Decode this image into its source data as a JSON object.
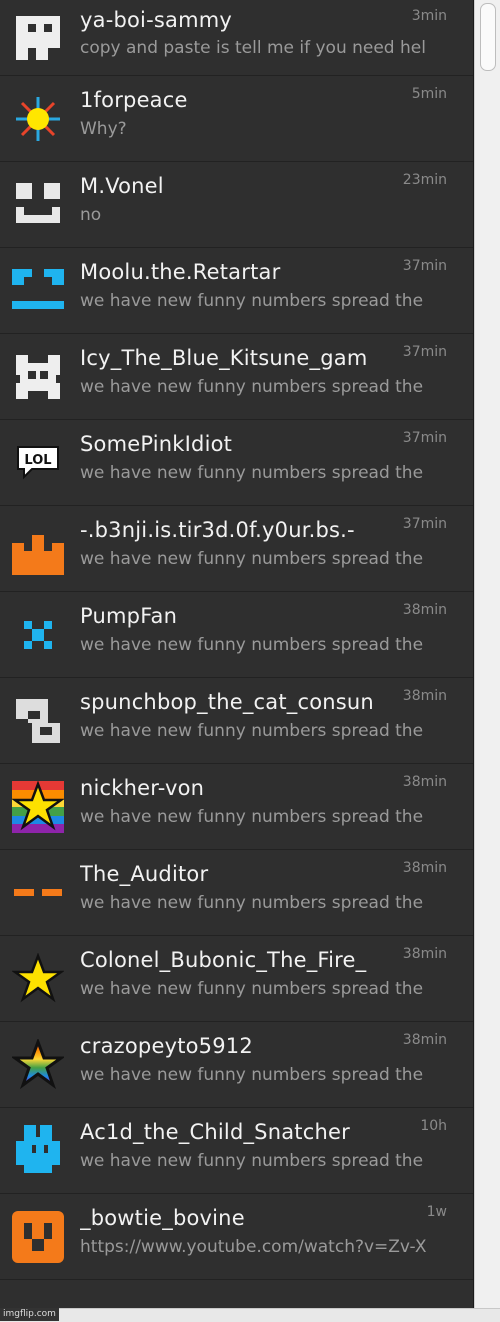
{
  "chats": [
    {
      "name": "ya-boi-sammy",
      "message": "copy and paste is tell me if you need hel",
      "time": "3min",
      "icon": "white-pixel-ghost-icon"
    },
    {
      "name": "1forpeace",
      "message": "Why?",
      "time": "5min",
      "icon": "sun-icon"
    },
    {
      "name": "M.Vonel",
      "message": "no",
      "time": "23min",
      "icon": "white-pixel-face-icon"
    },
    {
      "name": "Moolu.the.Retartar",
      "message": "we have new funny numbers spread the",
      "time": "37min",
      "icon": "blue-pixel-face-icon"
    },
    {
      "name": "Icy_The_Blue_Kitsune_gam",
      "message": "we have new funny numbers spread the",
      "time": "37min",
      "icon": "white-pixel-fox-icon"
    },
    {
      "name": "SomePinkIdiot",
      "message": "we have new funny numbers spread the",
      "time": "37min",
      "icon": "lol-speech-bubble-icon"
    },
    {
      "name": "-.b3nji.is.tir3d.0f.y0ur.bs.-",
      "message": "we have new funny numbers spread the",
      "time": "37min",
      "icon": "orange-crown-icon"
    },
    {
      "name": "PumpFan",
      "message": "we have new funny numbers spread the",
      "time": "38min",
      "icon": "blue-pixel-x-icon"
    },
    {
      "name": "spunchbop_the_cat_consun",
      "message": "we have new funny numbers spread the",
      "time": "38min",
      "icon": "white-pixel-glyph-icon"
    },
    {
      "name": "nickher-von",
      "message": "we have new funny numbers spread the",
      "time": "38min",
      "icon": "rainbow-star-icon"
    },
    {
      "name": "The_Auditor",
      "message": "we have new funny numbers spread the",
      "time": "38min",
      "icon": "orange-dashes-icon"
    },
    {
      "name": "Colonel_Bubonic_The_Fire_",
      "message": "we have new funny numbers spread the",
      "time": "38min",
      "icon": "yellow-star-icon"
    },
    {
      "name": "crazopeyto5912",
      "message": "we have new funny numbers spread the",
      "time": "38min",
      "icon": "rainbow-outline-star-icon"
    },
    {
      "name": "Ac1d_the_Child_Snatcher",
      "message": "we have new funny numbers spread the",
      "time": "10h",
      "icon": "blue-pixel-creature-icon"
    },
    {
      "name": "_bowtie_bovine",
      "message": "https://www.youtube.com/watch?v=Zv-X",
      "time": "1w",
      "icon": "orange-square-face-icon"
    }
  ],
  "watermark": "imgflip.com"
}
